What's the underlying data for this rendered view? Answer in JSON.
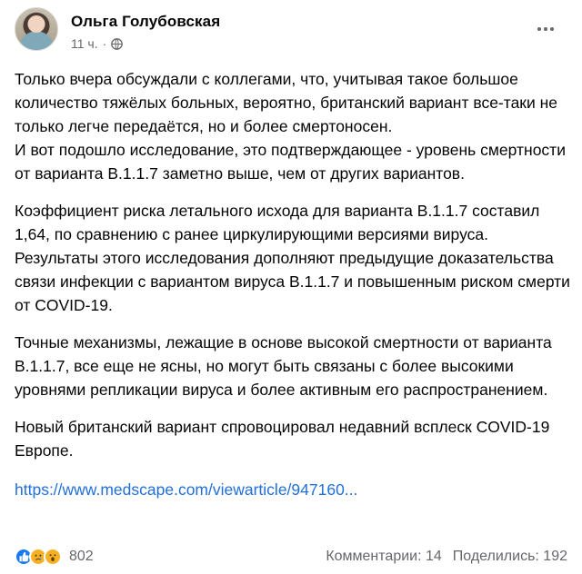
{
  "post": {
    "author": "Ольга Голубовская",
    "time": "11 ч.",
    "separator": "·",
    "paragraphs": [
      "Только вчера обсуждали с коллегами, что, учитывая такое большое количество тяжёлых больных, вероятно, британский вариант все-таки не только легче передаётся, но и более смертоносен.\nИ вот подошло исследование, это подтверждающее - уровень смертности от варианта B.1.1.7 заметно выше, чем от других вариантов.",
      " Коэффициент риска летального исхода для варианта B.1.1.7 составил 1,64, по сравнению с ранее циркулирующими версиями вируса. Результаты этого исследования дополняют предыдущие доказательства связи инфекции с вариантом вируса B.1.1.7 и повышенным риском смерти от COVID-19.",
      "Точные механизмы, лежащие в основе высокой смертности от варианта B.1.1.7, все еще не ясны, но могут быть связаны с более высокими уровнями репликации вируса и более активным его распространением.",
      "Новый британский вариант спровоцировал недавний всплеск COVID-19 Европе."
    ],
    "link": "https://www.medscape.com/viewarticle/947160..."
  },
  "footer": {
    "reaction_icons": [
      "like-icon",
      "sad-icon",
      "wow-icon"
    ],
    "reaction_count": "802",
    "comments": "Комментарии: 14",
    "shares": "Поделились: 192"
  },
  "colors": {
    "link": "#216fdb",
    "secondary_text": "#65676b",
    "like": "#1877f2",
    "emoji": "#f7b125"
  }
}
